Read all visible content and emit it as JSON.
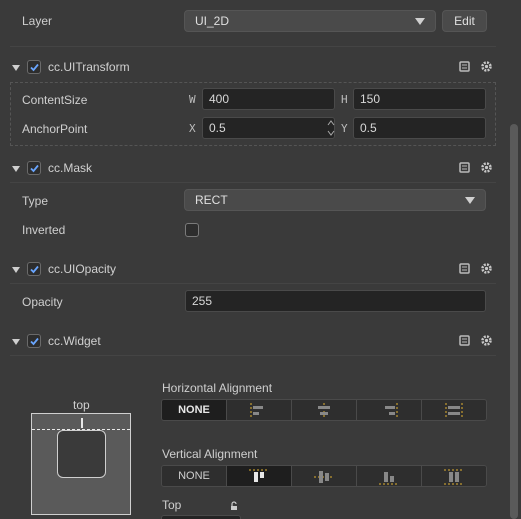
{
  "layer": {
    "label": "Layer",
    "value": "UI_2D",
    "edit_label": "Edit"
  },
  "ui_transform": {
    "title": "cc.UITransform",
    "content_size": {
      "label": "ContentSize",
      "w_axis": "W",
      "w": "400",
      "h_axis": "H",
      "h": "150"
    },
    "anchor_point": {
      "label": "AnchorPoint",
      "x_axis": "X",
      "x": "0.5",
      "y_axis": "Y",
      "y": "0.5"
    }
  },
  "mask": {
    "title": "cc.Mask",
    "type": {
      "label": "Type",
      "value": "RECT"
    },
    "inverted": {
      "label": "Inverted"
    }
  },
  "ui_opacity": {
    "title": "cc.UIOpacity",
    "opacity": {
      "label": "Opacity",
      "value": "255"
    }
  },
  "widget": {
    "title": "cc.Widget",
    "preview_top_label": "top",
    "horizontal": {
      "label": "Horizontal Alignment",
      "none_label": "NONE"
    },
    "vertical": {
      "label": "Vertical Alignment",
      "none_label": "NONE"
    },
    "top_label": "Top"
  },
  "colors": {
    "background": "#3a3a3a",
    "field": "#242424",
    "accent_yellow": "#e0b030",
    "check_blue": "#6aa6ff"
  }
}
